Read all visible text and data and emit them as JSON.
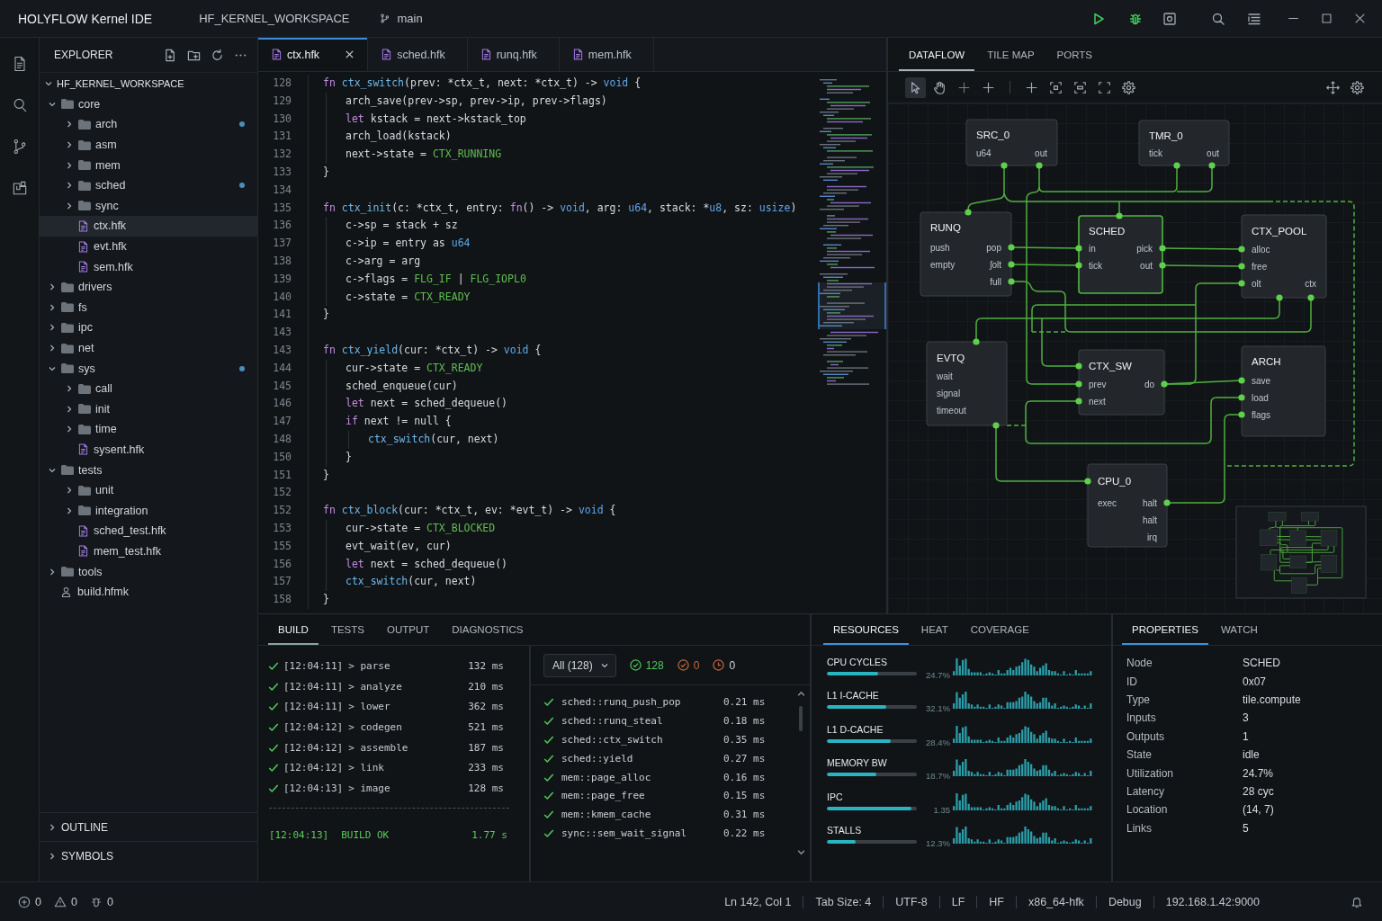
{
  "title_bar": {
    "app_title": "HOLYFLOW Kernel IDE",
    "workspace": "HF_KERNEL_WORKSPACE",
    "branch": "main"
  },
  "explorer": {
    "title": "EXPLORER",
    "workspace": {
      "label": "HF_KERNEL_WORKSPACE",
      "expanded": true,
      "children": [
        {
          "label": "core",
          "kind": "folder",
          "expanded": true,
          "modified": false,
          "selected": false,
          "children": [
            {
              "label": "arch",
              "kind": "folder",
              "expanded": false,
              "modified": true,
              "selected": false
            },
            {
              "label": "asm",
              "kind": "folder",
              "expanded": false,
              "modified": false,
              "selected": false
            },
            {
              "label": "mem",
              "kind": "folder",
              "expanded": false,
              "modified": false,
              "selected": false
            },
            {
              "label": "sched",
              "kind": "folder",
              "expanded": false,
              "modified": true,
              "selected": false
            },
            {
              "label": "sync",
              "kind": "folder",
              "expanded": false,
              "modified": false,
              "selected": false
            },
            {
              "label": "ctx.hfk",
              "kind": "file",
              "modified": false,
              "selected": true
            },
            {
              "label": "evt.hfk",
              "kind": "file",
              "modified": false,
              "selected": false
            },
            {
              "label": "sem.hfk",
              "kind": "file",
              "modified": false,
              "selected": false
            }
          ]
        },
        {
          "label": "drivers",
          "kind": "folder",
          "expanded": false,
          "modified": false,
          "selected": false
        },
        {
          "label": "fs",
          "kind": "folder",
          "expanded": false,
          "modified": false,
          "selected": false
        },
        {
          "label": "ipc",
          "kind": "folder",
          "expanded": false,
          "modified": false,
          "selected": false
        },
        {
          "label": "net",
          "kind": "folder",
          "expanded": false,
          "modified": false,
          "selected": false
        },
        {
          "label": "sys",
          "kind": "folder",
          "expanded": true,
          "modified": true,
          "selected": false,
          "children": [
            {
              "label": "call",
              "kind": "folder",
              "expanded": false,
              "modified": false,
              "selected": false
            },
            {
              "label": "init",
              "kind": "folder",
              "expanded": false,
              "modified": false,
              "selected": false
            },
            {
              "label": "time",
              "kind": "folder",
              "expanded": false,
              "modified": false,
              "selected": false
            },
            {
              "label": "sysent.hfk",
              "kind": "file",
              "modified": false,
              "selected": false
            }
          ]
        },
        {
          "label": "tests",
          "kind": "folder",
          "expanded": true,
          "modified": false,
          "selected": false,
          "children": [
            {
              "label": "unit",
              "kind": "folder",
              "expanded": false,
              "modified": false,
              "selected": false
            },
            {
              "label": "integration",
              "kind": "folder",
              "expanded": false,
              "modified": false,
              "selected": false
            },
            {
              "label": "sched_test.hfk",
              "kind": "file",
              "modified": false,
              "selected": false
            },
            {
              "label": "mem_test.hfk",
              "kind": "file",
              "modified": false,
              "selected": false
            }
          ]
        },
        {
          "label": "tools",
          "kind": "folder",
          "expanded": false,
          "modified": false,
          "selected": false
        },
        {
          "label": "build.hfmk",
          "kind": "build",
          "modified": false,
          "selected": false
        }
      ]
    },
    "sections": [
      {
        "label": "OUTLINE",
        "expanded": false
      },
      {
        "label": "SYMBOLS",
        "expanded": false
      }
    ]
  },
  "editor": {
    "tabs": [
      {
        "label": "ctx.hfk",
        "selected": true
      },
      {
        "label": "sched.hfk",
        "selected": false
      },
      {
        "label": "runq.hfk",
        "selected": false
      },
      {
        "label": "mem.hfk",
        "selected": false
      }
    ],
    "lines": [
      {
        "number": "128",
        "tokens": [
          {
            "kind": "keyword",
            "text": "fn "
          },
          {
            "kind": "func",
            "text": "ctx_switch"
          },
          {
            "kind": "plain",
            "text": "(prev: *ctx_t, next: *ctx_t) -> "
          },
          {
            "kind": "type",
            "text": "void"
          },
          {
            "kind": "plain",
            "text": " {"
          }
        ]
      },
      {
        "number": "129",
        "tokens": [
          {
            "kind": "plain",
            "text": "    arch_save(prev->sp, prev->ip, prev->flags)"
          }
        ]
      },
      {
        "number": "130",
        "tokens": [
          {
            "kind": "keyword",
            "text": "    let"
          },
          {
            "kind": "plain",
            "text": " kstack = next->kstack_top"
          }
        ]
      },
      {
        "number": "131",
        "tokens": [
          {
            "kind": "plain",
            "text": "    arch_load(kstack)"
          }
        ]
      },
      {
        "number": "132",
        "tokens": [
          {
            "kind": "plain",
            "text": "    next->state = "
          },
          {
            "kind": "const",
            "text": "CTX_RUNNING"
          }
        ]
      },
      {
        "number": "133",
        "tokens": [
          {
            "kind": "plain",
            "text": "}"
          }
        ]
      },
      {
        "number": "134"
      },
      {
        "number": "135",
        "tokens": [
          {
            "kind": "keyword",
            "text": "fn "
          },
          {
            "kind": "func",
            "text": "ctx_init"
          },
          {
            "kind": "plain",
            "text": "(c: *ctx_t, entry: "
          },
          {
            "kind": "keyword",
            "text": "fn"
          },
          {
            "kind": "plain",
            "text": "() -> "
          },
          {
            "kind": "type",
            "text": "void"
          },
          {
            "kind": "plain",
            "text": ", arg: "
          },
          {
            "kind": "type",
            "text": "u64"
          },
          {
            "kind": "plain",
            "text": ", stack: *"
          },
          {
            "kind": "type",
            "text": "u8"
          },
          {
            "kind": "plain",
            "text": ", sz: "
          },
          {
            "kind": "type",
            "text": "usize"
          },
          {
            "kind": "plain",
            "text": ")"
          }
        ]
      },
      {
        "number": "136",
        "tokens": [
          {
            "kind": "plain",
            "text": "    c->sp = stack + sz"
          }
        ]
      },
      {
        "number": "137",
        "tokens": [
          {
            "kind": "plain",
            "text": "    c->ip = entry as "
          },
          {
            "kind": "type",
            "text": "u64"
          }
        ]
      },
      {
        "number": "138",
        "tokens": [
          {
            "kind": "plain",
            "text": "    c->arg = arg"
          }
        ]
      },
      {
        "number": "139",
        "tokens": [
          {
            "kind": "plain",
            "text": "    c->flags = "
          },
          {
            "kind": "const",
            "text": "FLG_IF"
          },
          {
            "kind": "plain",
            "text": " | "
          },
          {
            "kind": "const",
            "text": "FLG_IOPL0"
          }
        ]
      },
      {
        "number": "140",
        "tokens": [
          {
            "kind": "plain",
            "text": "    c->state = "
          },
          {
            "kind": "const",
            "text": "CTX_READY"
          }
        ]
      },
      {
        "number": "141",
        "tokens": [
          {
            "kind": "plain",
            "text": "}"
          }
        ]
      },
      {
        "number": "143"
      },
      {
        "number": "143",
        "tokens": [
          {
            "kind": "keyword",
            "text": "fn "
          },
          {
            "kind": "func",
            "text": "ctx_yield"
          },
          {
            "kind": "plain",
            "text": "(cur: *ctx_t) -> "
          },
          {
            "kind": "type",
            "text": "void"
          },
          {
            "kind": "plain",
            "text": " {"
          }
        ]
      },
      {
        "number": "144",
        "tokens": [
          {
            "kind": "plain",
            "text": "    cur->state = "
          },
          {
            "kind": "const",
            "text": "CTX_READY"
          }
        ]
      },
      {
        "number": "145",
        "tokens": [
          {
            "kind": "plain",
            "text": "    sched_enqueue(cur)"
          }
        ]
      },
      {
        "number": "146",
        "tokens": [
          {
            "kind": "keyword",
            "text": "    let"
          },
          {
            "kind": "plain",
            "text": " next = sched_dequeue()"
          }
        ]
      },
      {
        "number": "147",
        "tokens": [
          {
            "kind": "keyword",
            "text": "    if"
          },
          {
            "kind": "plain",
            "text": " next != null {"
          }
        ]
      },
      {
        "number": "148",
        "tokens": [
          {
            "kind": "func",
            "text": "        ctx_switch"
          },
          {
            "kind": "plain",
            "text": "(cur, next)"
          }
        ]
      },
      {
        "number": "150",
        "tokens": [
          {
            "kind": "plain",
            "text": "    }"
          }
        ]
      },
      {
        "number": "151",
        "tokens": [
          {
            "kind": "plain",
            "text": "}"
          }
        ]
      },
      {
        "number": "152"
      },
      {
        "number": "152",
        "tokens": [
          {
            "kind": "keyword",
            "text": "fn "
          },
          {
            "kind": "func",
            "text": "ctx_block"
          },
          {
            "kind": "plain",
            "text": "(cur: *ctx_t, ev: *evt_t) -> "
          },
          {
            "kind": "type",
            "text": "void"
          },
          {
            "kind": "plain",
            "text": " {"
          }
        ]
      },
      {
        "number": "153",
        "tokens": [
          {
            "kind": "plain",
            "text": "    cur->state = "
          },
          {
            "kind": "const",
            "text": "CTX_BLOCKED"
          }
        ]
      },
      {
        "number": "155",
        "tokens": [
          {
            "kind": "plain",
            "text": "    evt_wait(ev, cur)"
          }
        ]
      },
      {
        "number": "156",
        "tokens": [
          {
            "kind": "keyword",
            "text": "    let"
          },
          {
            "kind": "plain",
            "text": " next = sched_dequeue()"
          }
        ]
      },
      {
        "number": "157",
        "tokens": [
          {
            "kind": "func",
            "text": "    ctx_switch"
          },
          {
            "kind": "plain",
            "text": "(cur, next)"
          }
        ]
      },
      {
        "number": "158",
        "tokens": [
          {
            "kind": "plain",
            "text": "}"
          }
        ]
      }
    ]
  },
  "dataflow": {
    "tabs": [
      {
        "label": "DATAFLOW",
        "selected": true
      },
      {
        "label": "TILE MAP",
        "selected": false
      },
      {
        "label": "PORTS",
        "selected": false
      }
    ],
    "tools": [
      {
        "selected": true
      },
      {
        "selected": false
      },
      {
        "selected": false
      },
      {
        "selected": false
      },
      {
        "selected": false
      },
      {
        "selected": false
      },
      {
        "selected": false
      },
      {
        "selected": false
      },
      {
        "selected": false
      },
      {
        "selected": false
      },
      {
        "selected": false
      }
    ],
    "nodes": [
      {
        "title": "SRC_0",
        "selected": false,
        "ports": [
          {
            "left": "u64",
            "right": "out"
          }
        ]
      },
      {
        "title": "TMR_0",
        "selected": false,
        "ports": [
          {
            "left": "tick",
            "right": "out"
          }
        ]
      },
      {
        "title": "RUNQ",
        "selected": false,
        "ports": [
          {
            "left": "push",
            "right": "pop"
          },
          {
            "left": "empty",
            "right": "ʃolt"
          },
          {
            "right": "full"
          }
        ]
      },
      {
        "title": "SCHED",
        "selected": true,
        "ports": [
          {
            "left": "in",
            "right": "pick"
          },
          {
            "left": "tick",
            "right": "out"
          }
        ]
      },
      {
        "title": "CTX_POOL",
        "selected": false,
        "ports": [
          {
            "left": "alloc"
          },
          {
            "left": "free"
          },
          {
            "left": "olt",
            "right": "ctx"
          }
        ]
      },
      {
        "title": "EVTQ",
        "selected": false,
        "ports": [
          {
            "left": "wait"
          },
          {
            "left": "signal"
          },
          {
            "left": "timeout"
          }
        ]
      },
      {
        "title": "CTX_SW",
        "selected": false,
        "ports": [
          {
            "left": "prev",
            "right": "do"
          },
          {
            "left": "next"
          }
        ]
      },
      {
        "title": "ARCH",
        "selected": false,
        "ports": [
          {
            "left": "save"
          },
          {
            "left": "load"
          },
          {
            "left": "flags"
          }
        ]
      },
      {
        "title": "CPU_0",
        "selected": false,
        "ports": [
          {
            "left": "exec",
            "right": "halt"
          },
          {
            "right": "halt"
          },
          {
            "right": "irq"
          }
        ]
      }
    ]
  },
  "bottom": {
    "tabs": [
      {
        "label": "BUILD",
        "selected": true
      },
      {
        "label": "TESTS",
        "selected": false
      },
      {
        "label": "OUTPUT",
        "selected": false
      },
      {
        "label": "DIAGNOSTICS",
        "selected": false
      }
    ],
    "build_log": [
      {
        "time": "[12:04:11]",
        "step": "> parse",
        "duration": "132 ms",
        "ok": true
      },
      {
        "time": "[12:04:11]",
        "step": "> analyze",
        "duration": "210 ms",
        "ok": true
      },
      {
        "time": "[12:04:11]",
        "step": "> lower",
        "duration": "362 ms",
        "ok": true
      },
      {
        "time": "[12:04:12]",
        "step": "> codegen",
        "duration": "521 ms",
        "ok": true
      },
      {
        "time": "[12:04:12]",
        "step": "> assemble",
        "duration": "187 ms",
        "ok": true
      },
      {
        "time": "[12:04:12]",
        "step": "> link",
        "duration": "233 ms",
        "ok": true
      },
      {
        "time": "[12:04:13]",
        "step": "> image",
        "duration": "128 ms",
        "ok": true
      }
    ],
    "build_result": {
      "time": "[12:04:13]",
      "status": "BUILD OK",
      "duration": "1.77 s"
    },
    "tests": {
      "filter": "All (128)",
      "passed": "128",
      "failed": "0",
      "skipped": "0",
      "rows": [
        {
          "name": "sched::runq_push_pop",
          "duration": "0.21 ms",
          "passed": true
        },
        {
          "name": "sched::runq_steal",
          "duration": "0.18 ms",
          "passed": true
        },
        {
          "name": "sched::ctx_switch",
          "duration": "0.35 ms",
          "passed": true
        },
        {
          "name": "sched::yield",
          "duration": "0.27 ms",
          "passed": true
        },
        {
          "name": "mem::page_alloc",
          "duration": "0.16 ms",
          "passed": true
        },
        {
          "name": "mem::page_free",
          "duration": "0.15 ms",
          "passed": true
        },
        {
          "name": "mem::kmem_cache",
          "duration": "0.31 ms",
          "passed": true
        },
        {
          "name": "sync::sem_wait_signal",
          "duration": "0.22 ms",
          "passed": true
        }
      ]
    }
  },
  "resources": {
    "tabs": [
      {
        "label": "RESOURCES",
        "selected": true
      },
      {
        "label": "HEAT",
        "selected": false
      },
      {
        "label": "COVERAGE",
        "selected": false
      }
    ],
    "rows": [
      {
        "label": "CPU CYCLES",
        "level": 0.57,
        "reading": "24.7%"
      },
      {
        "label": "L1 I-CACHE",
        "level": 0.66,
        "reading": "32.1%"
      },
      {
        "label": "L1 D-CACHE",
        "level": 0.71,
        "reading": "28.4%"
      },
      {
        "label": "MEMORY BW",
        "level": 0.55,
        "reading": "18.7%"
      },
      {
        "label": "IPC",
        "level": 0.94,
        "reading": "1.35"
      },
      {
        "label": "STALLS",
        "level": 0.32,
        "reading": "12.3%"
      }
    ]
  },
  "properties": {
    "tabs": [
      {
        "label": "PROPERTIES",
        "selected": true
      },
      {
        "label": "WATCH",
        "selected": false
      }
    ],
    "rows": [
      {
        "key": "Node",
        "value": "SCHED"
      },
      {
        "key": "ID",
        "value": "0x07"
      },
      {
        "key": "Type",
        "value": "tile.compute"
      },
      {
        "key": "Inputs",
        "value": "3"
      },
      {
        "key": "Outputs",
        "value": "1"
      },
      {
        "key": "State",
        "value": "idle"
      },
      {
        "key": "Utilization",
        "value": "24.7%"
      },
      {
        "key": "Latency",
        "value": "28 cyc"
      },
      {
        "key": "Location",
        "value": "(14, 7)"
      },
      {
        "key": "Links",
        "value": "5"
      }
    ]
  },
  "status_bar": {
    "indicators": [
      {
        "count": "0"
      },
      {
        "count": "0"
      },
      {
        "count": "0"
      }
    ],
    "items": [
      "Ln 142, Col 1",
      "Tab Size: 4",
      "UTF-8",
      "LF",
      "HF",
      "x86_64-hfk",
      "Debug",
      "192.168.1.42:9000"
    ]
  }
}
